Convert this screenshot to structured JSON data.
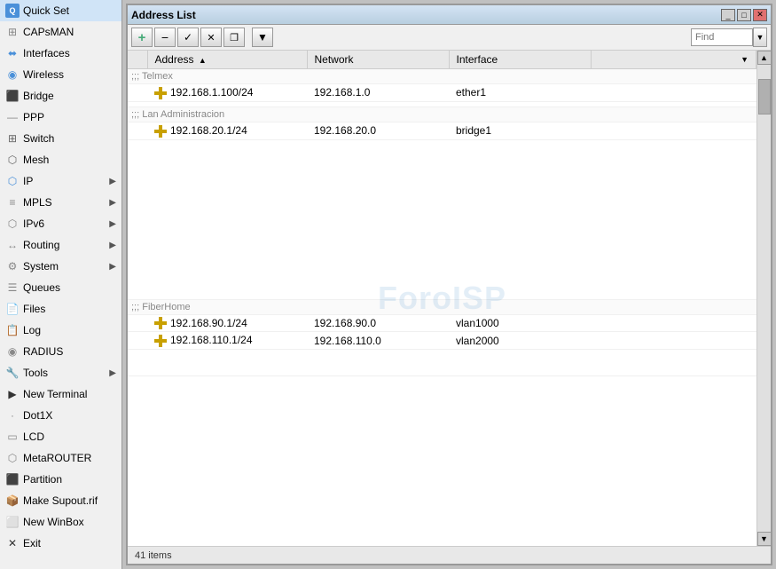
{
  "sidebar": {
    "items": [
      {
        "id": "quickset",
        "label": "Quick Set",
        "icon": "Q",
        "hasArrow": false
      },
      {
        "id": "capsman",
        "label": "CAPsMAN",
        "icon": "⊞",
        "hasArrow": false
      },
      {
        "id": "interfaces",
        "label": "Interfaces",
        "icon": "⬌",
        "hasArrow": false
      },
      {
        "id": "wireless",
        "label": "Wireless",
        "icon": "◉",
        "hasArrow": false
      },
      {
        "id": "bridge",
        "label": "Bridge",
        "icon": "⬛",
        "hasArrow": false
      },
      {
        "id": "ppp",
        "label": "PPP",
        "icon": "—",
        "hasArrow": false
      },
      {
        "id": "switch",
        "label": "Switch",
        "icon": "⊞",
        "hasArrow": false
      },
      {
        "id": "mesh",
        "label": "Mesh",
        "icon": "⬡",
        "hasArrow": false
      },
      {
        "id": "ip",
        "label": "IP",
        "icon": "⬡",
        "hasArrow": true
      },
      {
        "id": "mpls",
        "label": "MPLS",
        "icon": "≡",
        "hasArrow": true
      },
      {
        "id": "ipv6",
        "label": "IPv6",
        "icon": "⬡",
        "hasArrow": true
      },
      {
        "id": "routing",
        "label": "Routing",
        "icon": "↔",
        "hasArrow": true
      },
      {
        "id": "system",
        "label": "System",
        "icon": "⚙",
        "hasArrow": true
      },
      {
        "id": "queues",
        "label": "Queues",
        "icon": "☰",
        "hasArrow": false
      },
      {
        "id": "files",
        "label": "Files",
        "icon": "📄",
        "hasArrow": false
      },
      {
        "id": "log",
        "label": "Log",
        "icon": "📋",
        "hasArrow": false
      },
      {
        "id": "radius",
        "label": "RADIUS",
        "icon": "◉",
        "hasArrow": false
      },
      {
        "id": "tools",
        "label": "Tools",
        "icon": "🔧",
        "hasArrow": true
      },
      {
        "id": "newterminal",
        "label": "New Terminal",
        "icon": "▶",
        "hasArrow": false
      },
      {
        "id": "dot1x",
        "label": "Dot1X",
        "icon": "·",
        "hasArrow": false
      },
      {
        "id": "lcd",
        "label": "LCD",
        "icon": "▭",
        "hasArrow": false
      },
      {
        "id": "metarouter",
        "label": "MetaROUTER",
        "icon": "⬡",
        "hasArrow": false
      },
      {
        "id": "partition",
        "label": "Partition",
        "icon": "⬛",
        "hasArrow": false
      },
      {
        "id": "makesupout",
        "label": "Make Supout.rif",
        "icon": "📦",
        "hasArrow": false
      },
      {
        "id": "newwinbox",
        "label": "New WinBox",
        "icon": "⬜",
        "hasArrow": false
      },
      {
        "id": "exit",
        "label": "Exit",
        "icon": "✕",
        "hasArrow": false
      }
    ]
  },
  "window": {
    "title": "Address List",
    "toolbar": {
      "add_label": "+",
      "remove_label": "−",
      "check_label": "✓",
      "cross_label": "✕",
      "copy_label": "❐",
      "filter_label": "▼",
      "search_placeholder": "Find"
    },
    "table": {
      "columns": [
        {
          "id": "select",
          "label": ""
        },
        {
          "id": "address",
          "label": "Address",
          "sort": "asc"
        },
        {
          "id": "network",
          "label": "Network"
        },
        {
          "id": "interface",
          "label": "Interface"
        },
        {
          "id": "extra",
          "label": ""
        }
      ],
      "sections": [
        {
          "type": "section",
          "comment": ";;; Telmex",
          "rows": [
            {
              "address": "192.168.1.100/24",
              "network": "192.168.1.0",
              "interface": "ether1"
            }
          ]
        },
        {
          "type": "section",
          "comment": ";;; Lan Administracion",
          "rows": [
            {
              "address": "192.168.20.1/24",
              "network": "192.168.20.0",
              "interface": "bridge1"
            }
          ]
        },
        {
          "type": "section",
          "comment": ";;; FiberHome",
          "rows": [
            {
              "address": "192.168.90.1/24",
              "network": "192.168.90.0",
              "interface": "vlan1000"
            },
            {
              "address": "192.168.110.1/24",
              "network": "192.168.110.0",
              "interface": "vlan2000"
            }
          ]
        }
      ]
    },
    "watermark": "ForoISP",
    "statusbar": {
      "items_count": "41 items"
    }
  }
}
